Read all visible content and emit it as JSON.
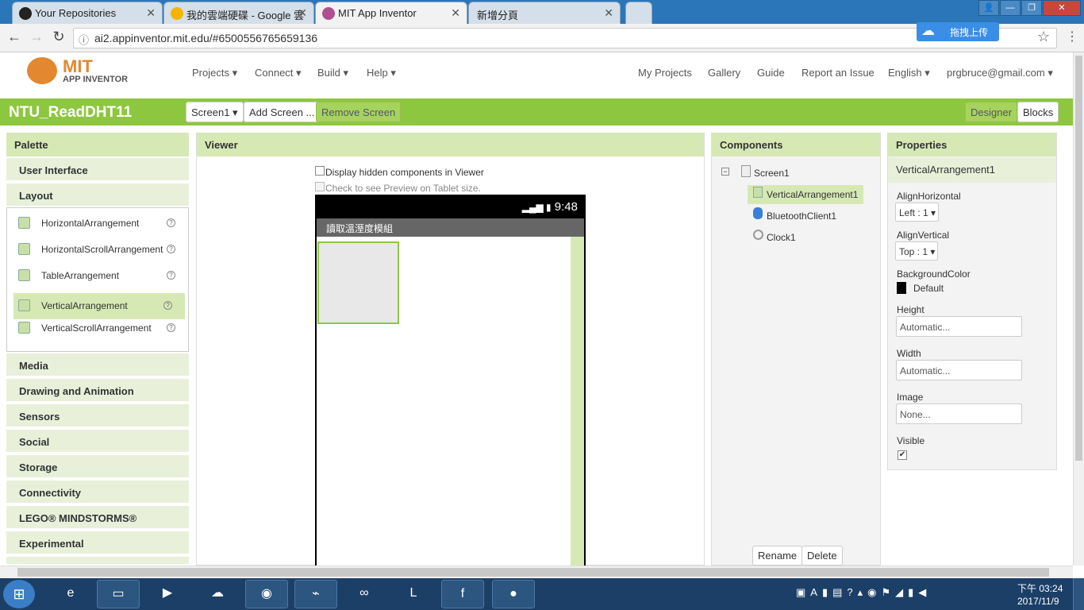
{
  "browser": {
    "tabs": [
      {
        "label": "Your Repositories"
      },
      {
        "label": "我的雲端硬碟 - Google 雲"
      },
      {
        "label": "MIT App Inventor"
      },
      {
        "label": "新增分頁"
      }
    ],
    "url": "ai2.appinventor.mit.edu/#6500556765659136",
    "upload_label": "拖拽上传"
  },
  "app": {
    "logo_main": "MIT",
    "logo_sub": "APP INVENTOR",
    "menus": [
      {
        "label": "Projects ▾"
      },
      {
        "label": "Connect ▾"
      },
      {
        "label": "Build ▾"
      },
      {
        "label": "Help ▾"
      }
    ],
    "right_menus": [
      {
        "label": "My Projects"
      },
      {
        "label": "Gallery"
      },
      {
        "label": "Guide"
      },
      {
        "label": "Report an Issue"
      },
      {
        "label": "English ▾"
      },
      {
        "label": "prgbruce@gmail.com ▾"
      }
    ],
    "project_name": "NTU_ReadDHT11",
    "screen_select": "Screen1 ▾",
    "add_screen": "Add Screen ...",
    "remove_screen": "Remove Screen",
    "designer": "Designer",
    "blocks": "Blocks"
  },
  "palette": {
    "title": "Palette",
    "cat_ui": "User Interface",
    "cat_layout": "Layout",
    "items": [
      {
        "label": "HorizontalArrangement"
      },
      {
        "label": "HorizontalScrollArrangement"
      },
      {
        "label": "TableArrangement"
      },
      {
        "label": "VerticalArrangement"
      },
      {
        "label": "VerticalScrollArrangement"
      }
    ],
    "cats_after": [
      {
        "label": "Media"
      },
      {
        "label": "Drawing and Animation"
      },
      {
        "label": "Sensors"
      },
      {
        "label": "Social"
      },
      {
        "label": "Storage"
      },
      {
        "label": "Connectivity"
      },
      {
        "label": "LEGO® MINDSTORMS®"
      },
      {
        "label": "Experimental"
      }
    ]
  },
  "viewer": {
    "title": "Viewer",
    "hidden_cb": "Display hidden components in Viewer",
    "tablet_cb": "Check to see Preview on Tablet size.",
    "time": "9:48",
    "screen_title": "讀取溫溼度模組"
  },
  "components": {
    "title": "Components",
    "root": "Screen1",
    "children": [
      {
        "label": "VerticalArrangement1"
      },
      {
        "label": "BluetoothClient1"
      },
      {
        "label": "Clock1"
      }
    ],
    "rename": "Rename",
    "delete": "Delete"
  },
  "properties": {
    "title": "Properties",
    "component": "VerticalArrangement1",
    "align_h_label": "AlignHorizontal",
    "align_h_value": "Left : 1 ▾",
    "align_v_label": "AlignVertical",
    "align_v_value": "Top : 1 ▾",
    "bg_label": "BackgroundColor",
    "bg_value": "Default",
    "height_label": "Height",
    "height_value": "Automatic...",
    "width_label": "Width",
    "width_value": "Automatic...",
    "image_label": "Image",
    "image_value": "None...",
    "visible_label": "Visible"
  },
  "taskbar": {
    "time": "下午 03:24",
    "date": "2017/11/9"
  },
  "colors": {
    "accent": "#8dc73f",
    "panel_header": "#d6e9b5"
  }
}
